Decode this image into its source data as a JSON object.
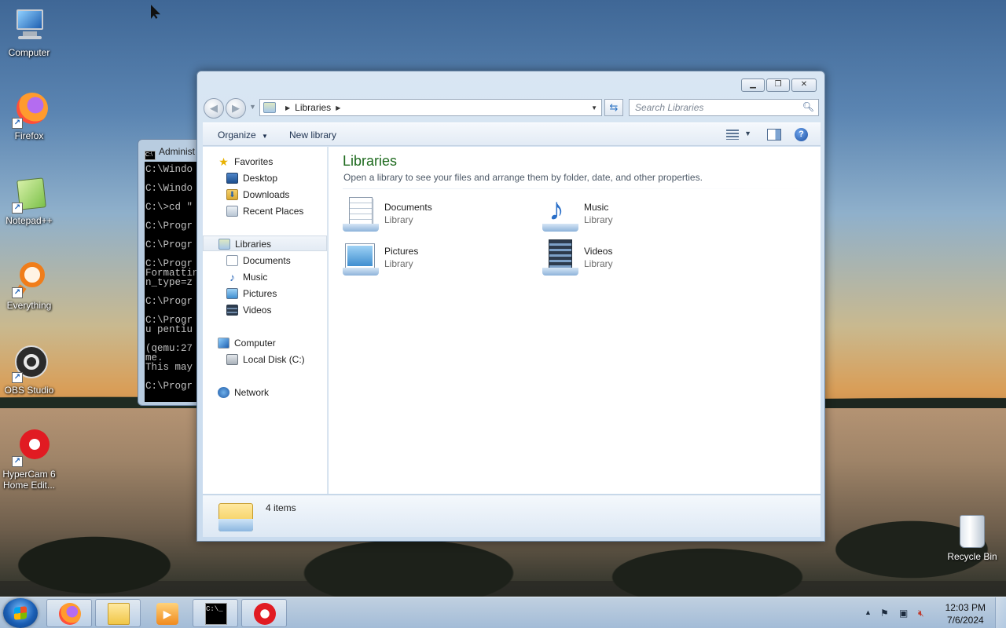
{
  "desktop": {
    "icons": [
      {
        "label": "Computer"
      },
      {
        "label": "Firefox"
      },
      {
        "label": "Notepad++"
      },
      {
        "label": "Everything"
      },
      {
        "label": "OBS Studio"
      },
      {
        "label": "HyperCam 6 Home Edit..."
      }
    ],
    "recycle_bin": "Recycle Bin"
  },
  "cmd_window": {
    "title": "Administ",
    "lines": [
      "C:\\Windo",
      "C:\\Windo",
      "C:\\>cd \"",
      "C:\\Progr",
      "C:\\Progr",
      "C:\\Progr\nFormattin\nn_type=z",
      "C:\\Progr",
      "C:\\Progr\nu pentiu",
      "(qemu:27\nme.\nThis may",
      "C:\\Progr"
    ]
  },
  "explorer": {
    "address": {
      "segments": [
        "Libraries"
      ]
    },
    "search": {
      "placeholder": "Search Libraries"
    },
    "toolbar": {
      "organize": "Organize",
      "new_library": "New library"
    },
    "nav": {
      "favorites": "Favorites",
      "desktop": "Desktop",
      "downloads": "Downloads",
      "recent_places": "Recent Places",
      "libraries": "Libraries",
      "documents": "Documents",
      "music": "Music",
      "pictures": "Pictures",
      "videos": "Videos",
      "computer": "Computer",
      "local_disk": "Local Disk (C:)",
      "network": "Network"
    },
    "content": {
      "title": "Libraries",
      "description": "Open a library to see your files and arrange them by folder, date, and other properties.",
      "libraries": [
        {
          "name": "Documents",
          "kind": "Library"
        },
        {
          "name": "Music",
          "kind": "Library"
        },
        {
          "name": "Pictures",
          "kind": "Library"
        },
        {
          "name": "Videos",
          "kind": "Library"
        }
      ]
    },
    "status": {
      "count": "4 items"
    }
  },
  "taskbar": {
    "apps": [
      "firefox-icon",
      "explorer-icon",
      "media-player-icon",
      "cmd-icon",
      "hypercam-icon"
    ],
    "time": "12:03 PM",
    "date": "7/6/2024"
  }
}
